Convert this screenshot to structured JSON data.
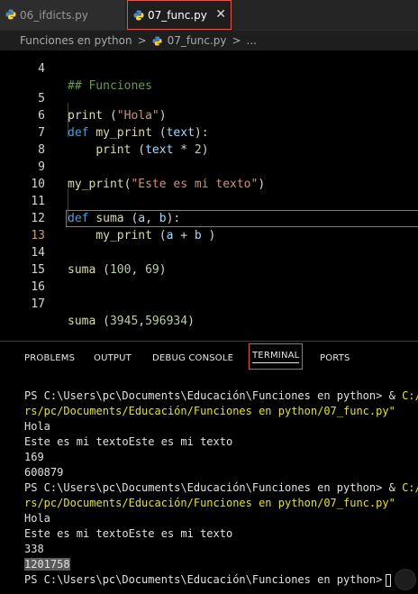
{
  "tabs": [
    {
      "label": "06_ifdicts.py",
      "active": false,
      "icon": "python-icon"
    },
    {
      "label": "07_func.py",
      "active": true,
      "icon": "python-icon",
      "close": "✕"
    }
  ],
  "breadcrumb": {
    "folder": "Funciones en python",
    "file": "07_func.py",
    "more": "...",
    "sep": ">"
  },
  "editor": {
    "lines": [
      {
        "no": "4",
        "code": "## Funciones"
      },
      {
        "no": "5",
        "code": "print (\"Hola\")"
      },
      {
        "no": "6",
        "code": "def my_print (text):"
      },
      {
        "no": "7",
        "code": "    print (text * 2)"
      },
      {
        "no": "8",
        "code": ""
      },
      {
        "no": "9",
        "code": "my_print(\"Este es mi texto\")"
      },
      {
        "no": "10",
        "code": ""
      },
      {
        "no": "11",
        "code": "def suma (a, b):"
      },
      {
        "no": "12",
        "code": "    my_print (a + b )"
      },
      {
        "no": "13",
        "code": ""
      },
      {
        "no": "14",
        "code": "suma (100, 69)"
      },
      {
        "no": "15",
        "code": ""
      },
      {
        "no": "16",
        "code": ""
      },
      {
        "no": "17",
        "code": "suma (3945,596934)"
      }
    ]
  },
  "panel": {
    "tabs": [
      "PROBLEMS",
      "OUTPUT",
      "DEBUG CONSOLE",
      "TERMINAL",
      "PORTS"
    ],
    "active_tab": "TERMINAL",
    "terminal": {
      "prompt": "PS C:\\Users\\pc\\Documents\\Educación\\Funciones en python>",
      "cmd_amp": "&",
      "cmd_cut": "C:/Us",
      "cmd_cont": "rs/pc/Documents/Educación/Funciones en python/07_func.py\"",
      "run1": [
        "Hola",
        "Este es mi textoEste es mi texto",
        "169",
        "600879"
      ],
      "run2": [
        "Hola",
        "Este es mi textoEste es mi texto",
        "338"
      ],
      "selected_output": "1201758"
    }
  },
  "colors": {
    "accent": "#e5534b",
    "keyword": "#569cd6",
    "function": "#dcdcaa",
    "string": "#ce9178",
    "number": "#b5cea8",
    "variable": "#9cdcfe",
    "terminal_path": "#e5e510"
  }
}
